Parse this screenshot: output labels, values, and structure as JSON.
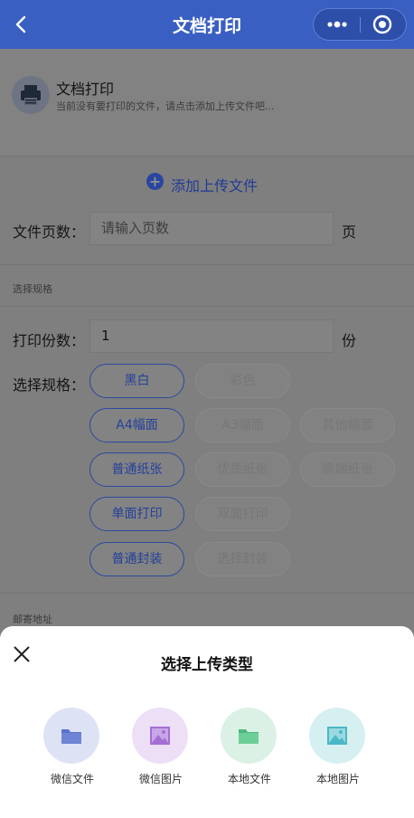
{
  "header": {
    "title": "文档打印",
    "colors": {
      "bar": "#3a5fc3"
    }
  },
  "doc_card": {
    "title": "文档打印",
    "subtitle": "当前没有要打印的文件，请点击添加上传文件吧...",
    "icon": "printer-icon"
  },
  "upload": {
    "label": "添加上传文件"
  },
  "pages": {
    "label": "文件页数：",
    "placeholder": "请输入页数",
    "unit": "页"
  },
  "spec_section": {
    "title": "选择规格"
  },
  "copies": {
    "label": "打印份数：",
    "value": "1",
    "unit": "份"
  },
  "spec": {
    "label": "选择规格：",
    "rows": [
      {
        "options": [
          {
            "label": "黑白",
            "selected": true
          },
          {
            "label": "彩色",
            "selected": false
          }
        ]
      },
      {
        "options": [
          {
            "label": "A4幅面",
            "selected": true
          },
          {
            "label": "A3幅面",
            "selected": false
          },
          {
            "label": "其他幅面",
            "selected": false
          }
        ]
      },
      {
        "options": [
          {
            "label": "普通纸张",
            "selected": true
          },
          {
            "label": "优质纸张",
            "selected": false
          },
          {
            "label": "高端纸张",
            "selected": false
          }
        ]
      },
      {
        "options": [
          {
            "label": "单面打印",
            "selected": true
          },
          {
            "label": "双面打印",
            "selected": false
          }
        ]
      },
      {
        "options": [
          {
            "label": "普通封装",
            "selected": true
          },
          {
            "label": "选择封装",
            "selected": false
          }
        ]
      }
    ]
  },
  "address_section": {
    "title": "邮寄地址"
  },
  "sheet": {
    "title": "选择上传类型",
    "options": [
      {
        "label": "微信文件",
        "icon": "folder-icon",
        "bg": "#dde3f5",
        "color": "#5b73cc"
      },
      {
        "label": "微信图片",
        "icon": "image-icon",
        "bg": "#ecdff6",
        "color": "#a46fd4"
      },
      {
        "label": "本地文件",
        "icon": "folder-icon",
        "bg": "#dcf1e6",
        "color": "#5ec48c"
      },
      {
        "label": "本地图片",
        "icon": "image-icon",
        "bg": "#d6f0f1",
        "color": "#4bb8c6"
      }
    ]
  }
}
